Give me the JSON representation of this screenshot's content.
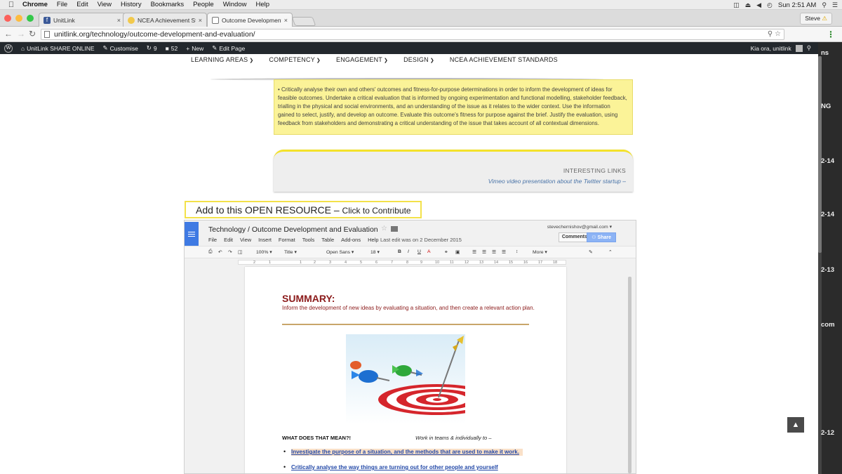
{
  "mac_menu": {
    "app": "Chrome",
    "items": [
      "File",
      "Edit",
      "View",
      "History",
      "Bookmarks",
      "People",
      "Window",
      "Help"
    ],
    "clock": "Sun 2:51 AM"
  },
  "browser": {
    "tabs": [
      {
        "title": "UnitLink",
        "icon": "facebook-icon"
      },
      {
        "title": "NCEA Achievement Standa",
        "icon": "ncea-icon"
      },
      {
        "title": "Outcome Development and",
        "icon": "page-icon"
      }
    ],
    "profile": "Steve",
    "url": "unitlink.org/technology/outcome-development-and-evaluation/"
  },
  "wp_bar": {
    "site": "UnitLink SHARE ONLINE",
    "customise": "Customise",
    "updates": "9",
    "comments": "52",
    "new": "New",
    "edit_page": "Edit Page",
    "greeting": "Kia ora, unitlink"
  },
  "side_bleed": [
    "ns",
    "NG",
    "2-14",
    "2-14",
    "2-13",
    "com",
    "2-12"
  ],
  "site_nav": [
    {
      "label": "LEARNING AREAS",
      "has_menu": true
    },
    {
      "label": "COMPETENCY",
      "has_menu": true
    },
    {
      "label": "ENGAGEMENT",
      "has_menu": true
    },
    {
      "label": "DESIGN",
      "has_menu": true
    },
    {
      "label": "NCEA ACHIEVEMENT STANDARDS",
      "has_menu": false
    }
  ],
  "yellow_box": {
    "text": "• Critically analyse their own and others' outcomes and fitness-for-purpose determinations in order to inform the development of ideas for feasible outcomes. Undertake a critical evaluation that is informed by ongoing experimentation and functional modelling, stakeholder feedback, trialling in the physical and social environments, and an understanding of the issue as it relates to the wider context. Use the information gained to select, justify, and develop an outcome. Evaluate this outcome's fitness for purpose against the brief. Justify the evaluation, using feedback from stakeholders and demonstrating a critical understanding of the issue that takes account of all contextual dimensions."
  },
  "links_box": {
    "heading": "INTERESTING LINKS",
    "link": "Vimeo video presentation about the Twitter startup –"
  },
  "contribute": {
    "main": "Add to this OPEN RESOURCE –",
    "sub": "Click to Contribute"
  },
  "gdoc": {
    "title": "Technology / Outcome Development and Evaluation",
    "menus": [
      "File",
      "Edit",
      "View",
      "Insert",
      "Format",
      "Tools",
      "Table",
      "Add-ons",
      "Help"
    ],
    "last_edit": "Last edit was on 2 December 2015",
    "email": "stevechernishov@gmail.com",
    "comments_label": "Comments",
    "share_label": "Share",
    "zoom": "100%",
    "style": "Title",
    "font": "Open Sans",
    "font_size": "18",
    "more": "More",
    "ruler": [
      "2",
      "1",
      "1",
      "2",
      "3",
      "4",
      "5",
      "6",
      "7",
      "8",
      "9",
      "10",
      "11",
      "12",
      "13",
      "14",
      "15",
      "16",
      "17",
      "18"
    ],
    "summary_heading": "SUMMARY:",
    "summary_text": "Inform the development of new ideas by evaluating a situation, and then create a relevant action plan.",
    "what_heading": "WHAT DOES THAT MEAN?!",
    "teams_text": "Work in teams & individually to –",
    "bullets": [
      "Investigate the purpose of a situation, and the methods that are used to make it work.",
      "Critically analyse the way things are turning out for other people and yourself"
    ]
  },
  "colors": {
    "wp_bar": "#23282d",
    "yellow": "#fbf398",
    "accent_yellow": "#f4e22b",
    "summary_red": "#8b1a1a",
    "link_blue": "#2349a8"
  }
}
